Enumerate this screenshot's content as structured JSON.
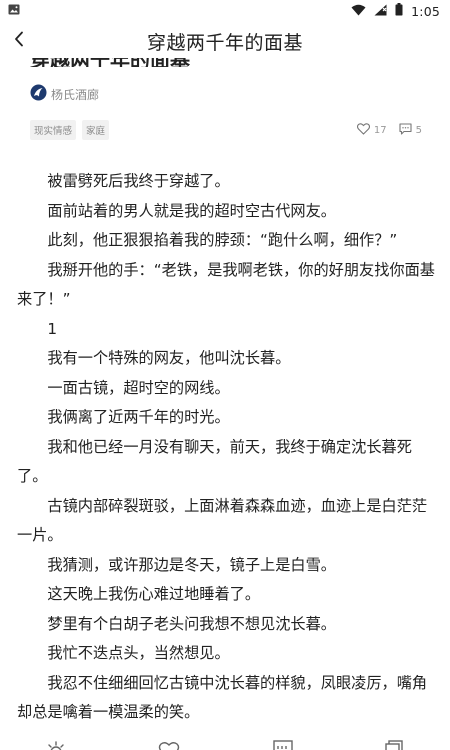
{
  "status_bar": {
    "time": "1:05"
  },
  "header": {
    "title": "穿越两千年的面基"
  },
  "article_title": "穿越两千年的面基",
  "author": {
    "name": "杨氏酒廊"
  },
  "tags": [
    "现实情感",
    "家庭"
  ],
  "stats": {
    "likes": "17",
    "comments": "5"
  },
  "paragraphs": [
    "被雷劈死后我终于穿越了。",
    "面前站着的男人就是我的超时空古代网友。",
    "此刻，他正狠狠掐着我的脖颈：“跑什么啊，细作？”",
    "我掰开他的手：“老铁，是我啊老铁，你的好朋友找你面基来了！”",
    "1",
    "我有一个特殊的网友，他叫沈长暮。",
    "一面古镜，超时空的网线。",
    "我俩离了近两千年的时光。",
    "我和他已经一月没有聊天，前天，我终于确定沈长暮死了。",
    "古镜内部碎裂斑驳，上面淋着森森血迹，血迹上是白茫茫一片。",
    "我猜测，或许那边是冬天，镜子上是白雪。",
    "这天晚上我伤心难过地睡着了。",
    "梦里有个白胡子老头问我想不想见沈长暮。",
    "我忙不迭点头，当然想见。",
    "我忍不住细细回忆古镜中沈长暮的样貌，凤眼凌厉，嘴角却总是噙着一模温柔的笑。"
  ],
  "icons": {
    "status_left": "image-icon",
    "wifi": "wifi-icon",
    "signal": "signal-icon",
    "battery": "battery-icon",
    "back": "back-arrow-icon",
    "author_logo": "author-logo-icon",
    "like": "heart-icon",
    "comment": "comment-icon",
    "bottom": [
      "brightness-icon",
      "heart-icon",
      "catalog-icon",
      "copy-icon"
    ]
  }
}
